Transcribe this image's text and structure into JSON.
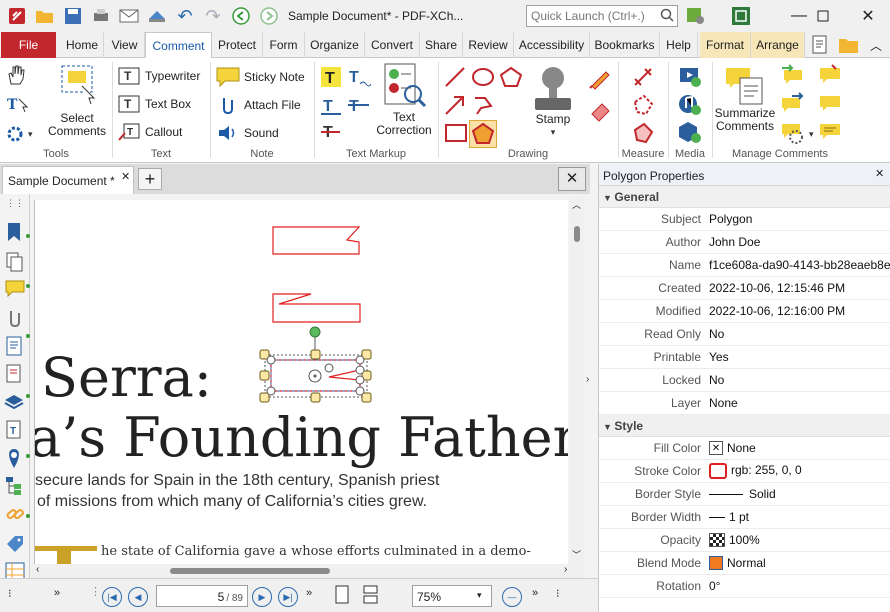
{
  "window": {
    "title": "Sample Document* - PDF-XCh...",
    "quick_launch_placeholder": "Quick Launch (Ctrl+.)"
  },
  "tabs": [
    {
      "label": "File"
    },
    {
      "label": "Home"
    },
    {
      "label": "View"
    },
    {
      "label": "Comment"
    },
    {
      "label": "Protect"
    },
    {
      "label": "Form"
    },
    {
      "label": "Organize"
    },
    {
      "label": "Convert"
    },
    {
      "label": "Share"
    },
    {
      "label": "Review"
    },
    {
      "label": "Accessibility"
    },
    {
      "label": "Bookmarks"
    },
    {
      "label": "Help"
    },
    {
      "label": "Format"
    },
    {
      "label": "Arrange"
    }
  ],
  "ribbon": {
    "groups": [
      "Tools",
      "Text",
      "Note",
      "Text Markup",
      "Drawing",
      "Measure",
      "Media",
      "Manage Comments"
    ],
    "select_comments": "Select Comments",
    "typewriter": "Typewriter",
    "text_box": "Text Box",
    "callout": "Callout",
    "sticky_note": "Sticky Note",
    "attach_file": "Attach File",
    "sound": "Sound",
    "text_correction": "Text Correction",
    "stamp": "Stamp",
    "summarize_comments": "Summarize Comments"
  },
  "document": {
    "tab_label": "Sample Document *",
    "heading_line1": "Serra:",
    "heading_line2": "a’s Founding Father",
    "body_line1": "secure lands for Spain in the 18th century, Spanish priest",
    "body_line2": "of missions from which many of California’s cities grew.",
    "body_line3": "he state of California gave a     whose efforts culminated in a demo-"
  },
  "status": {
    "page": "5",
    "page_total": "/ 89",
    "zoom": "75%"
  },
  "properties": {
    "title": "Polygon Properties",
    "general_label": "General",
    "general": [
      {
        "key": "Subject",
        "value": "Polygon"
      },
      {
        "key": "Author",
        "value": "John Doe"
      },
      {
        "key": "Name",
        "value": "f1ce608a-da90-4143-bb28eaeb8e..."
      },
      {
        "key": "Created",
        "value": "2022-10-06, 12:15:46 PM"
      },
      {
        "key": "Modified",
        "value": "2022-10-06, 12:16:00 PM"
      },
      {
        "key": "Read Only",
        "value": "No"
      },
      {
        "key": "Printable",
        "value": "Yes"
      },
      {
        "key": "Locked",
        "value": "No"
      },
      {
        "key": "Layer",
        "value": "None"
      }
    ],
    "style_label": "Style",
    "style": [
      {
        "key": "Fill Color",
        "value": "None"
      },
      {
        "key": "Stroke Color",
        "value": "rgb: 255, 0, 0"
      },
      {
        "key": "Border Style",
        "value": "Solid"
      },
      {
        "key": "Border Width",
        "value": "1 pt"
      },
      {
        "key": "Opacity",
        "value": "100%"
      },
      {
        "key": "Blend Mode",
        "value": "Normal"
      },
      {
        "key": "Rotation",
        "value": "0°"
      }
    ]
  },
  "colors": {
    "accent": "#1a5aa8",
    "file_tab": "#c1272d",
    "stroke": "#ff0000",
    "context_tab": "#f7e7b8"
  }
}
